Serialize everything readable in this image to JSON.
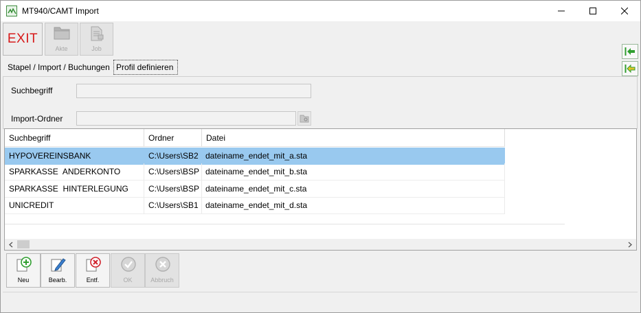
{
  "window": {
    "title": "MT940/CAMT Import",
    "controls": [
      "minimize",
      "maximize",
      "close"
    ]
  },
  "toolbar": {
    "exit_label": "EXIT",
    "akte_label": "Akte",
    "job_label": "Job",
    "right_icons": [
      "arrow-left-green-icon",
      "arrow-left-yellow-green-icon"
    ]
  },
  "tabs": [
    {
      "label": "Stapel / Import / Buchungen"
    },
    {
      "label": "Profil definieren",
      "active": true
    }
  ],
  "filter": {
    "suchbegriff_label": "Suchbegriff",
    "suchbegriff_value": "",
    "import_ordner_label": "Import-Ordner",
    "import_ordner_value": ""
  },
  "grid": {
    "columns": [
      "Suchbegriff",
      "Ordner",
      "Datei"
    ],
    "rows": [
      {
        "such": "HYPOVEREINSBANK",
        "ordner": "C:\\Users\\SB2",
        "datei": "dateiname_endet_mit_a.sta",
        "selected": true
      },
      {
        "such": "SPARKASSE  ANDERKONTO",
        "ordner": "C:\\Users\\BSP",
        "datei": "dateiname_endet_mit_b.sta"
      },
      {
        "such": "SPARKASSE  HINTERLEGUNG",
        "ordner": "C:\\Users\\BSP",
        "datei": "dateiname_endet_mit_c.sta"
      },
      {
        "such": "UNICREDIT",
        "ordner": "C:\\Users\\SB1",
        "datei": "dateiname_endet_mit_d.sta"
      }
    ]
  },
  "buttons": {
    "neu": "Neu",
    "bearb": "Bearb.",
    "entf": "Entf.",
    "ok": "OK",
    "abbruch": "Abbruch"
  },
  "colors": {
    "selection": "#99c9ef",
    "exit_text": "#d71a1a",
    "accent_green": "#2f9e2f",
    "delete_red": "#d0202a"
  }
}
